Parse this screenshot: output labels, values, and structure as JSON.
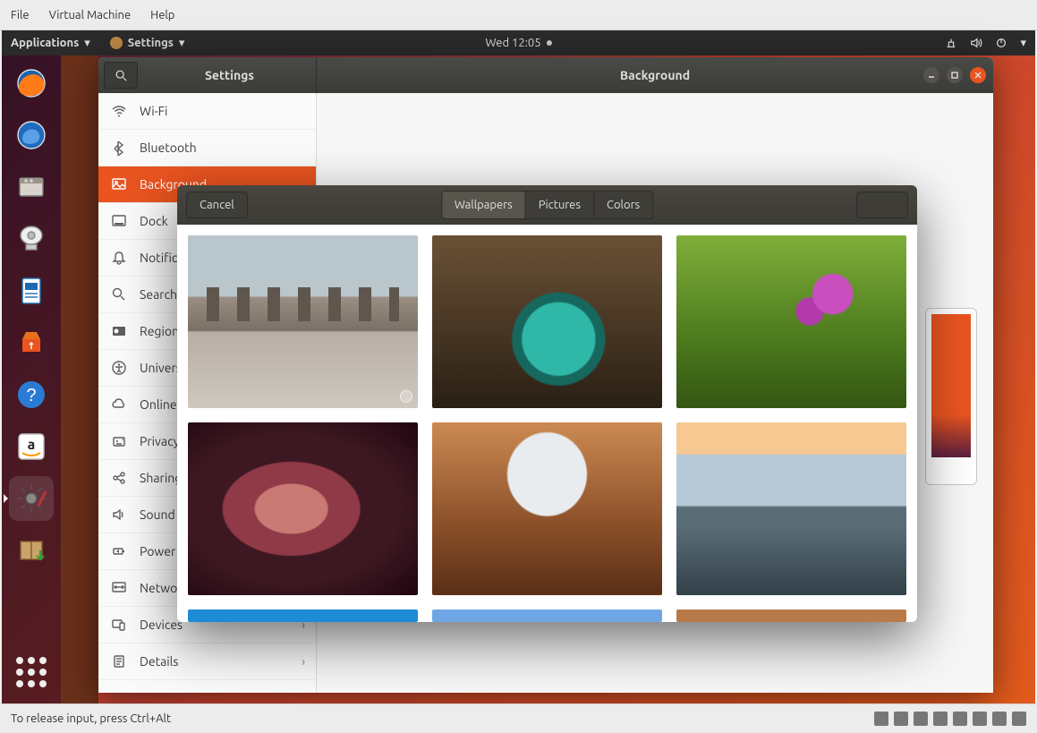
{
  "host": {
    "menu": {
      "file": "File",
      "vm": "Virtual Machine",
      "help": "Help"
    },
    "status_hint": "To release input, press Ctrl+Alt"
  },
  "panel": {
    "applications": "Applications",
    "settings": "Settings",
    "clock": "Wed 12:05"
  },
  "launcher_icons": [
    "firefox",
    "thunderbird",
    "files",
    "rhythmbox",
    "writer",
    "software",
    "help",
    "amazon",
    "settings",
    "package"
  ],
  "settings_window": {
    "sidebar_title": "Settings",
    "content_title": "Background",
    "items": [
      {
        "icon": "wifi",
        "label": "Wi-Fi"
      },
      {
        "icon": "bluetooth",
        "label": "Bluetooth"
      },
      {
        "icon": "background",
        "label": "Background",
        "selected": true
      },
      {
        "icon": "dock",
        "label": "Dock"
      },
      {
        "icon": "bell",
        "label": "Notifications"
      },
      {
        "icon": "search",
        "label": "Search"
      },
      {
        "icon": "globe",
        "label": "Region & Language"
      },
      {
        "icon": "accessibility",
        "label": "Universal Access"
      },
      {
        "icon": "cloud",
        "label": "Online Accounts"
      },
      {
        "icon": "privacy",
        "label": "Privacy"
      },
      {
        "icon": "share",
        "label": "Sharing"
      },
      {
        "icon": "sound",
        "label": "Sound"
      },
      {
        "icon": "power",
        "label": "Power"
      },
      {
        "icon": "network",
        "label": "Network"
      },
      {
        "icon": "devices",
        "label": "Devices",
        "chevron": true
      },
      {
        "icon": "details",
        "label": "Details",
        "chevron": true
      }
    ]
  },
  "dialog": {
    "cancel": "Cancel",
    "tabs": {
      "wallpapers": "Wallpapers",
      "pictures": "Pictures",
      "colors": "Colors"
    },
    "active_tab": "wallpapers",
    "select": ""
  }
}
